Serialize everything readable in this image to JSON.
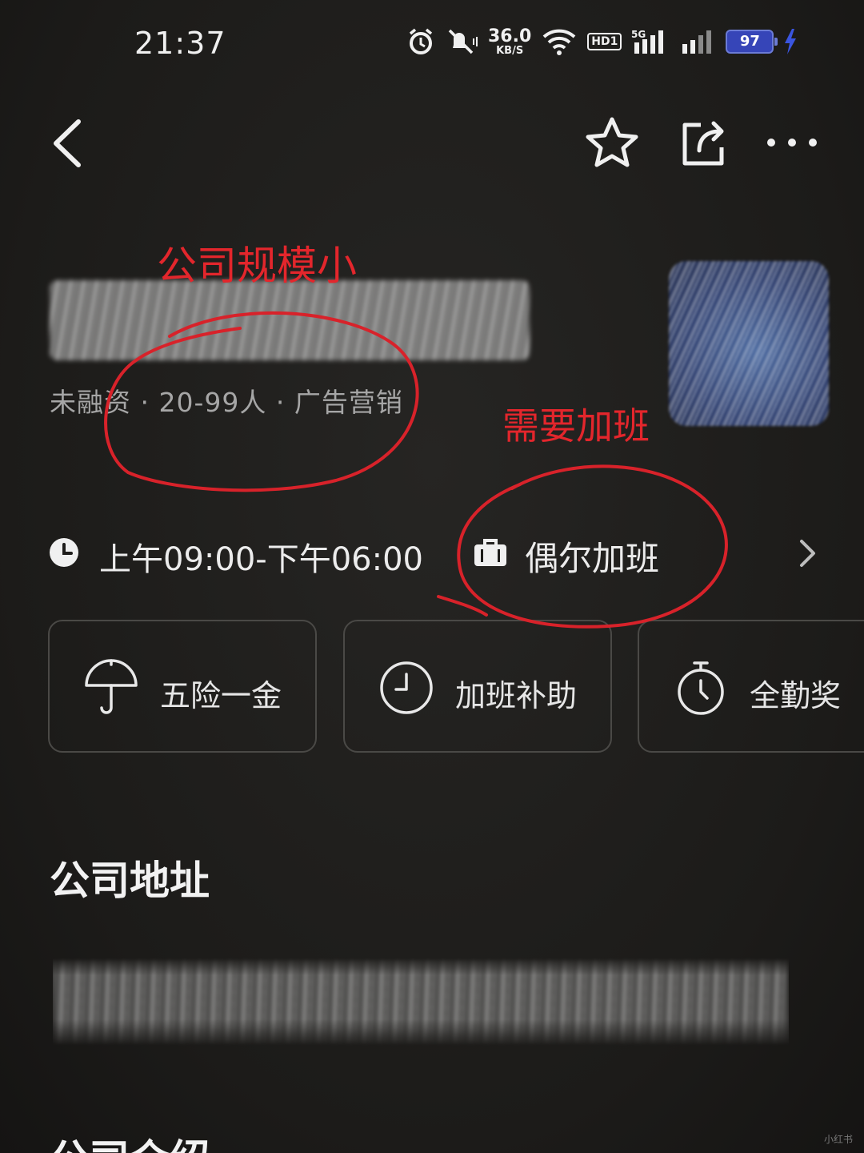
{
  "status_bar": {
    "time": "21:37",
    "net_speed": "36.0",
    "net_unit": "KB/S",
    "hd_label": "HD1",
    "signal_5g": "5G",
    "battery": "97",
    "icons": [
      "alarm-icon",
      "mute-icon",
      "wifi-icon",
      "signal-icon",
      "charging-icon"
    ]
  },
  "nav": {
    "icons": [
      "back-icon",
      "star-icon",
      "share-icon",
      "more-icon"
    ]
  },
  "company": {
    "name": "",
    "meta": "未融资 · 20-99人 · 广告营销"
  },
  "work": {
    "hours": "上午09:00-下午06:00",
    "overtime": "偶尔加班"
  },
  "benefits": [
    {
      "label": "五险一金",
      "icon": "umbrella-icon"
    },
    {
      "label": "加班补助",
      "icon": "clock-icon"
    },
    {
      "label": "全勤奖",
      "icon": "stopwatch-icon"
    }
  ],
  "sections": {
    "address_title": "公司地址",
    "intro_title": "公司介绍"
  },
  "annotations": {
    "scale_note": "公司规模小",
    "overtime_note": "需要加班",
    "color": "#e3262c"
  },
  "watermark": "小红书"
}
